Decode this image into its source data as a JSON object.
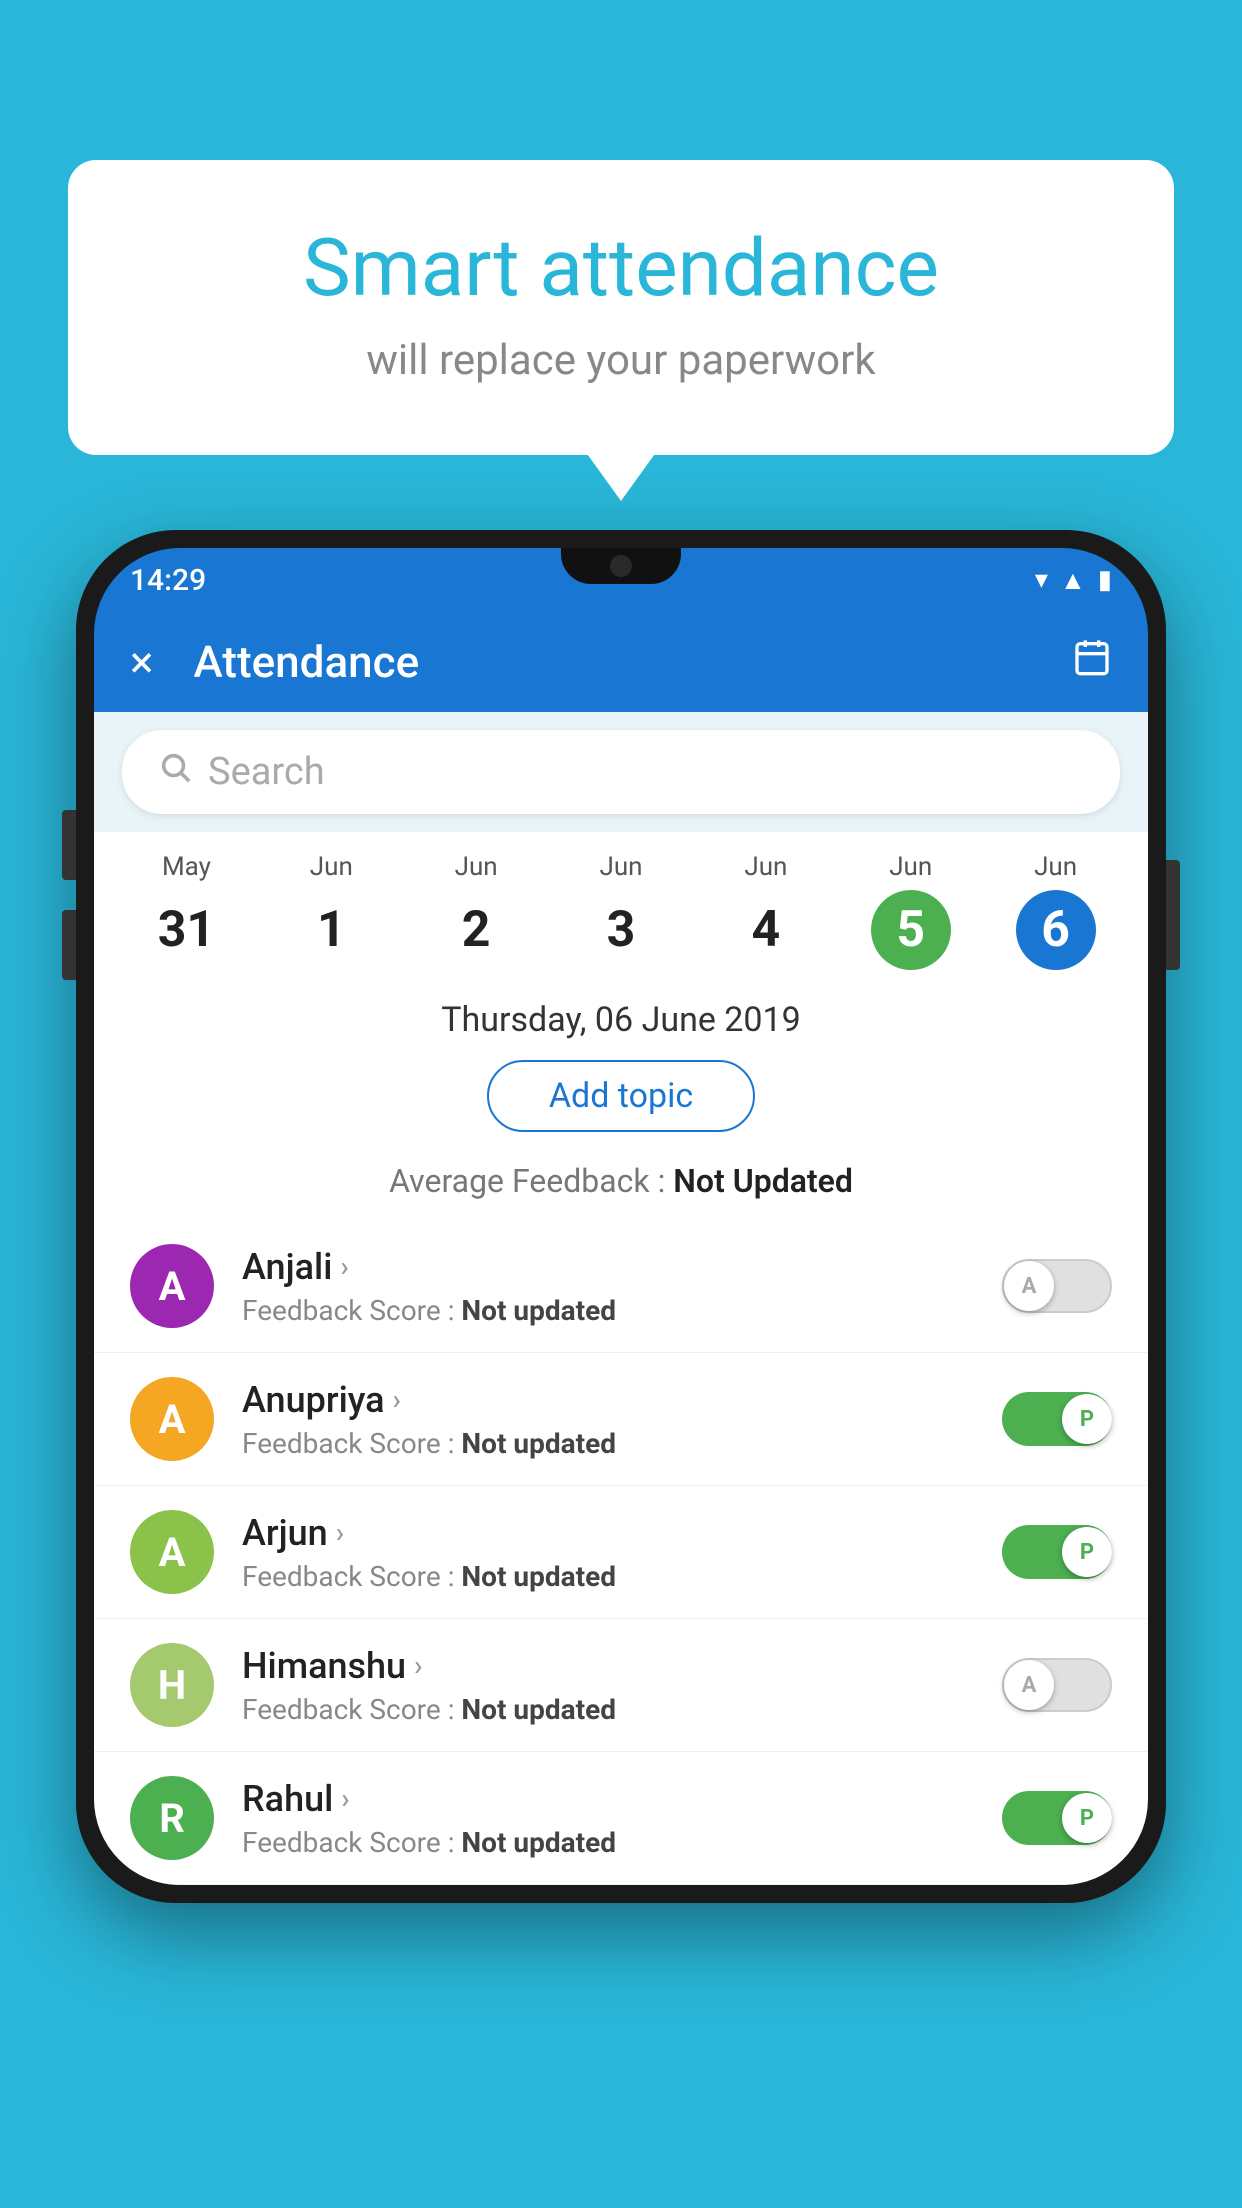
{
  "background": {
    "color": "#29b6d8"
  },
  "bubble": {
    "title": "Smart attendance",
    "subtitle": "will replace your paperwork"
  },
  "status_bar": {
    "time": "14:29"
  },
  "app_bar": {
    "title": "Attendance",
    "close_label": "×",
    "calendar_label": "📅"
  },
  "search": {
    "placeholder": "Search"
  },
  "calendar": {
    "days": [
      {
        "month": "May",
        "date": "31",
        "style": "normal"
      },
      {
        "month": "Jun",
        "date": "1",
        "style": "normal"
      },
      {
        "month": "Jun",
        "date": "2",
        "style": "normal"
      },
      {
        "month": "Jun",
        "date": "3",
        "style": "normal"
      },
      {
        "month": "Jun",
        "date": "4",
        "style": "normal"
      },
      {
        "month": "Jun",
        "date": "5",
        "style": "green"
      },
      {
        "month": "Jun",
        "date": "6",
        "style": "blue"
      }
    ],
    "selected_date": "Thursday, 06 June 2019"
  },
  "add_topic_label": "Add topic",
  "avg_feedback_label": "Average Feedback :",
  "avg_feedback_value": "Not Updated",
  "students": [
    {
      "name": "Anjali",
      "avatar_letter": "A",
      "avatar_color": "#9c27b0",
      "feedback_label": "Feedback Score :",
      "feedback_value": "Not updated",
      "status": "absent"
    },
    {
      "name": "Anupriya",
      "avatar_letter": "A",
      "avatar_color": "#f5a623",
      "feedback_label": "Feedback Score :",
      "feedback_value": "Not updated",
      "status": "present"
    },
    {
      "name": "Arjun",
      "avatar_letter": "A",
      "avatar_color": "#8bc34a",
      "feedback_label": "Feedback Score :",
      "feedback_value": "Not updated",
      "status": "present"
    },
    {
      "name": "Himanshu",
      "avatar_letter": "H",
      "avatar_color": "#a5c96e",
      "feedback_label": "Feedback Score :",
      "feedback_value": "Not updated",
      "status": "absent"
    },
    {
      "name": "Rahul",
      "avatar_letter": "R",
      "avatar_color": "#4caf50",
      "feedback_label": "Feedback Score :",
      "feedback_value": "Not updated",
      "status": "present"
    }
  ]
}
